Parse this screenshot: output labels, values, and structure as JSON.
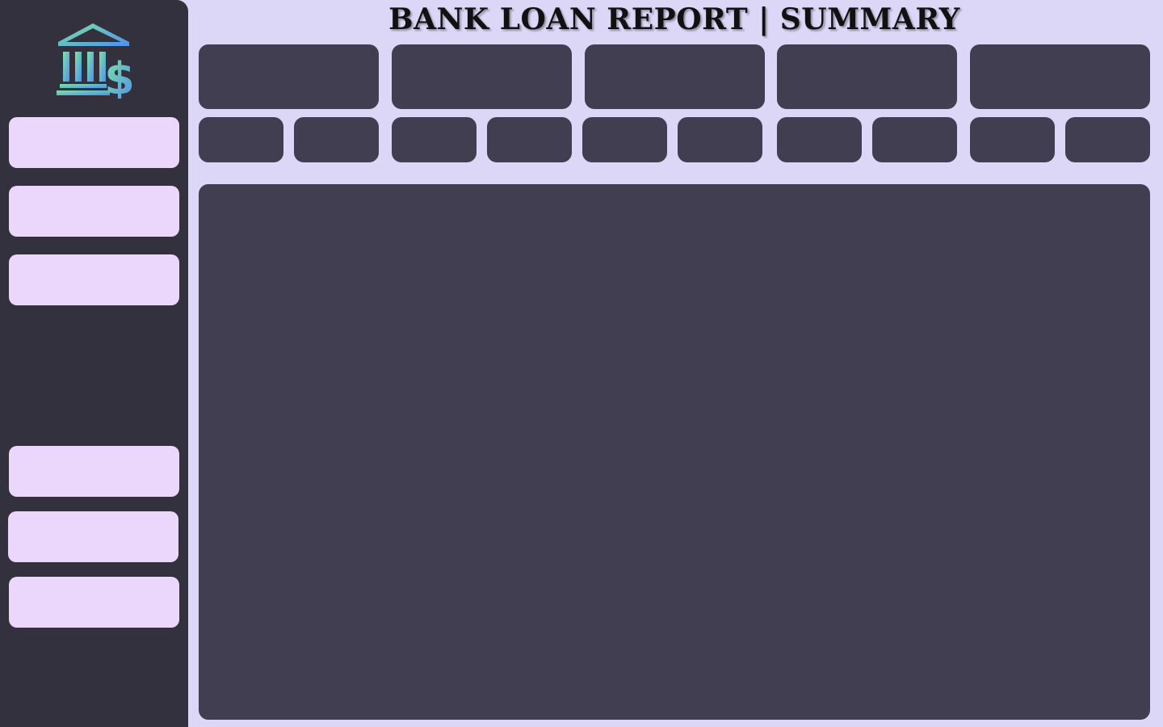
{
  "header": {
    "title": "BANK LOAN REPORT | SUMMARY"
  },
  "logo": {
    "icon": "bank-dollar-icon",
    "gradient_start": "#7fe3a0",
    "gradient_end": "#4f8ff0"
  },
  "sidebar": {
    "items": [
      {
        "label": "",
        "icon": ""
      },
      {
        "label": "",
        "icon": ""
      },
      {
        "label": "",
        "icon": ""
      },
      {
        "label": "",
        "icon": ""
      },
      {
        "label": "",
        "icon": ""
      },
      {
        "label": "",
        "icon": ""
      }
    ]
  },
  "kpis": [
    {
      "label": "",
      "value": ""
    },
    {
      "label": "",
      "value": ""
    },
    {
      "label": "",
      "value": ""
    },
    {
      "label": "",
      "value": ""
    },
    {
      "label": "",
      "value": ""
    }
  ],
  "sub_kpis": [
    {
      "label": "",
      "value": ""
    },
    {
      "label": "",
      "value": ""
    },
    {
      "label": "",
      "value": ""
    },
    {
      "label": "",
      "value": ""
    },
    {
      "label": "",
      "value": ""
    },
    {
      "label": "",
      "value": ""
    },
    {
      "label": "",
      "value": ""
    },
    {
      "label": "",
      "value": ""
    },
    {
      "label": "",
      "value": ""
    },
    {
      "label": "",
      "value": ""
    }
  ],
  "colors": {
    "page_background": "#dcd6f7",
    "sidebar_background": "#34313f",
    "panel_background": "#413e52",
    "nav_button": "#ead7fb"
  }
}
